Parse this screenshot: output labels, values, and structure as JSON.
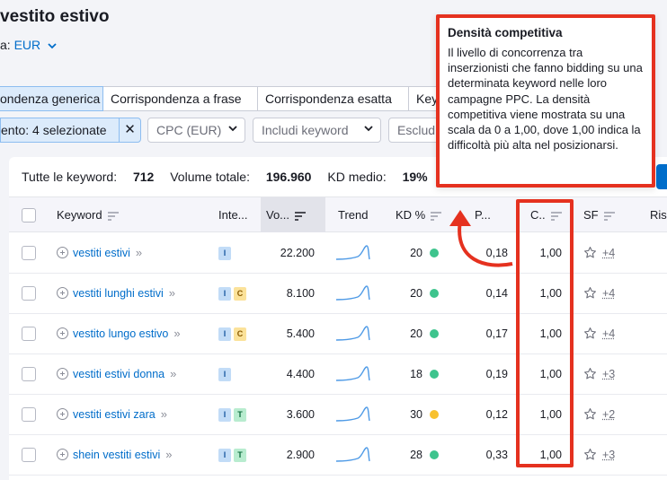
{
  "header": {
    "title": "vestito estivo",
    "currency_label": "a:",
    "currency_value": "EUR"
  },
  "tabs": [
    {
      "label": "ondenza generica",
      "active": true
    },
    {
      "label": "Corrispondenza a frase",
      "active": false
    },
    {
      "label": "Corrispondenza esatta",
      "active": false
    },
    {
      "label": "Key",
      "active": false
    }
  ],
  "filters": {
    "selected_chip": "ento: 4 selezionate",
    "cpc": "CPC (EUR)",
    "include": "Includi keyword",
    "exclude": "Esclud"
  },
  "summary": {
    "kw_label": "Tutte le keyword:",
    "kw_value": "712",
    "vol_label": "Volume totale:",
    "vol_value": "196.960",
    "kd_label": "KD medio:",
    "kd_value": "19%"
  },
  "columns": {
    "keyword": "Keyword",
    "intent": "Inte...",
    "volume": "Vo...",
    "trend": "Trend",
    "kd": "KD %",
    "cpc": "P...",
    "com": "C..",
    "sf": "SF",
    "results": "Risu"
  },
  "rows": [
    {
      "keyword": "vestiti estivi",
      "intents": [
        "I"
      ],
      "volume": "22.200",
      "kd": "20",
      "kd_color": "#3ec48d",
      "cpc": "0,18",
      "com": "1,00",
      "sf": "+4"
    },
    {
      "keyword": "vestiti lunghi estivi",
      "intents": [
        "I",
        "C"
      ],
      "volume": "8.100",
      "kd": "20",
      "kd_color": "#3ec48d",
      "cpc": "0,14",
      "com": "1,00",
      "sf": "+4"
    },
    {
      "keyword": "vestito lungo estivo",
      "intents": [
        "I",
        "C"
      ],
      "volume": "5.400",
      "kd": "20",
      "kd_color": "#3ec48d",
      "cpc": "0,17",
      "com": "1,00",
      "sf": "+4"
    },
    {
      "keyword": "vestiti estivi donna",
      "intents": [
        "I"
      ],
      "volume": "4.400",
      "kd": "18",
      "kd_color": "#3ec48d",
      "cpc": "0,19",
      "com": "1,00",
      "sf": "+3"
    },
    {
      "keyword": "vestiti estivi zara",
      "intents": [
        "I",
        "T"
      ],
      "volume": "3.600",
      "kd": "30",
      "kd_color": "#f8c12e",
      "cpc": "0,12",
      "com": "1,00",
      "sf": "+2"
    },
    {
      "keyword": "shein vestiti estivi",
      "intents": [
        "I",
        "T"
      ],
      "volume": "2.900",
      "kd": "28",
      "kd_color": "#3ec48d",
      "cpc": "0,33",
      "com": "1,00",
      "sf": "+3"
    }
  ],
  "tooltip": {
    "title": "Densità competitiva",
    "body": "Il livello di concorrenza tra inserzionisti che fanno bidding su una determinata keyword nelle loro campagne PPC. La densità competitiva viene mostrata su una scala da 0 a 1,00, dove 1,00 indica la difficoltà più alta nel posizionarsi."
  },
  "colors": {
    "accent": "#006dca",
    "highlight": "#e5311f"
  }
}
